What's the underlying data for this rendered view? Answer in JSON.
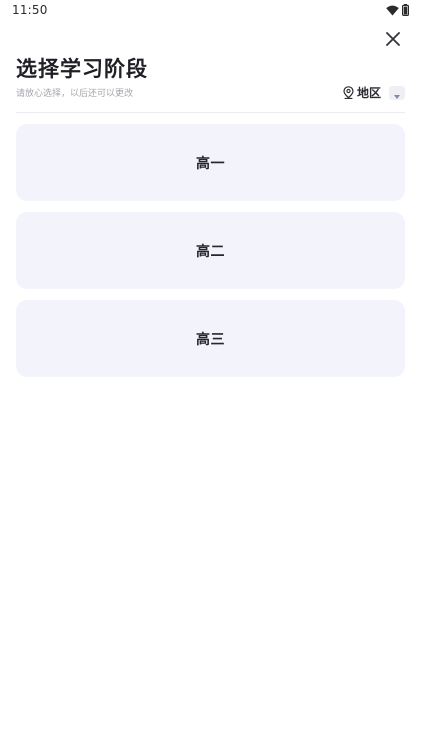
{
  "status_bar": {
    "time": "11:50",
    "icons": [
      "wifi-icon",
      "battery-icon"
    ]
  },
  "header": {
    "close_icon": "close-icon",
    "title": "选择学习阶段",
    "subtitle": "请放心选择，以后还可以更改",
    "region": {
      "icon": "location-pin-icon",
      "label": "地区",
      "dropdown_icon": "triangle-down-icon"
    }
  },
  "grades": [
    {
      "label": "高一"
    },
    {
      "label": "高二"
    },
    {
      "label": "高三"
    }
  ],
  "colors": {
    "card_background": "#f3f3fb",
    "title_text": "#1f1f26",
    "subtitle_text": "#a6a6ad",
    "divider": "#ececf0"
  }
}
